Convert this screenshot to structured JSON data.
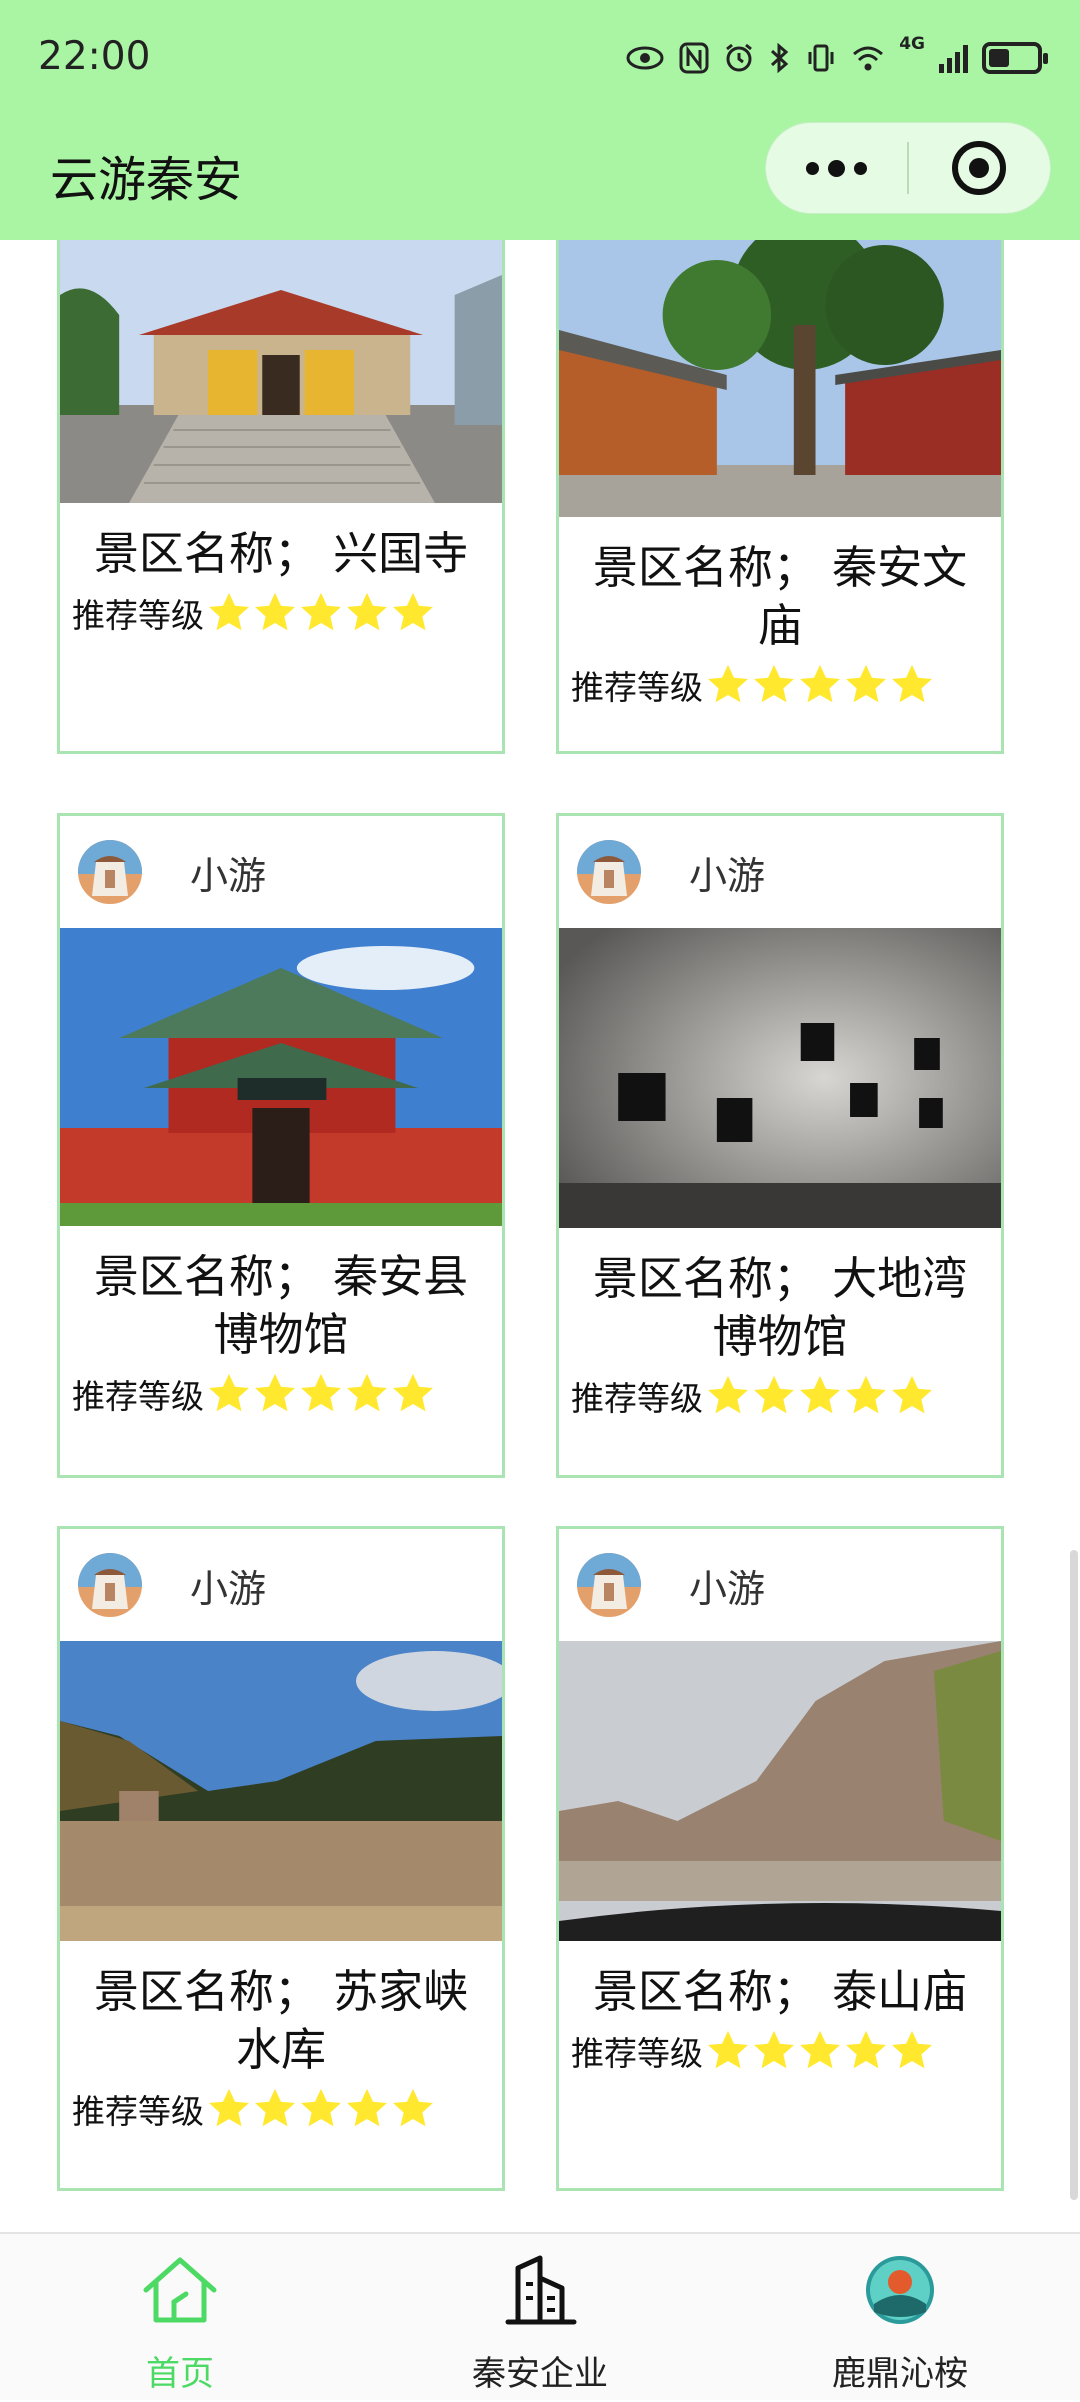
{
  "status_bar": {
    "time": "22:00",
    "network": "4G"
  },
  "header": {
    "title": "云游秦安"
  },
  "rank_label": "推荐等级",
  "cards": [
    {
      "name": "景区名称；  兴国寺",
      "stars": 5,
      "photo_icon": "temple-gate-photo"
    },
    {
      "name": "景区名称；  秦安文庙",
      "stars": 5,
      "photo_icon": "temple-courtyard-photo"
    },
    {
      "user": "小游",
      "name": "景区名称；  秦安县博物馆",
      "stars": 5,
      "photo_icon": "museum-building-photo"
    },
    {
      "user": "小游",
      "name": "景区名称；  大地湾博物馆",
      "stars": 5,
      "photo_icon": "gallery-wall-photo"
    },
    {
      "user": "小游",
      "name": "景区名称；  苏家峡水库",
      "stars": 5,
      "photo_icon": "reservoir-photo"
    },
    {
      "user": "小游",
      "name": "景区名称；  泰山庙",
      "stars": 5,
      "photo_icon": "mountain-road-photo"
    }
  ],
  "tabbar": {
    "items": [
      {
        "label": "首页",
        "icon": "home-icon",
        "active": true
      },
      {
        "label": "秦安企业",
        "icon": "building-icon",
        "active": false
      },
      {
        "label": "鹿鼎沁桉",
        "icon": "logo-icon",
        "active": false
      }
    ]
  },
  "colors": {
    "header_bg": "#a9f5a4",
    "card_border": "#a9e4b2",
    "star": "#ffe82e",
    "tab_active": "#4cd964"
  }
}
